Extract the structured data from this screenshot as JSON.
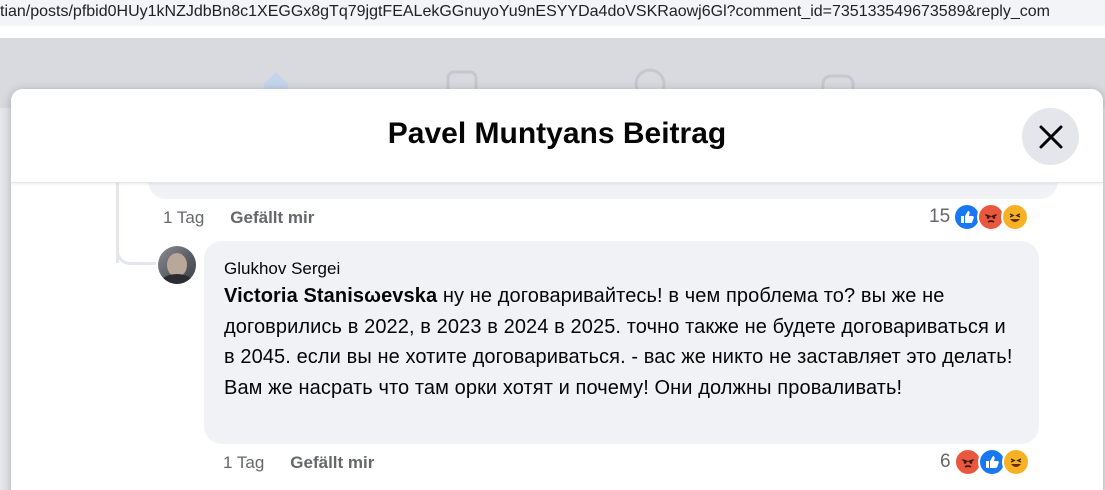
{
  "url": "tian/posts/pfbid0HUy1kNZJdbBn8c1XEGGx8gTq79jgtFEALekGGnuyoYu9nESYYDa4doVSKRaowj6Gl?comment_id=735133549673589&reply_com",
  "modal": {
    "title": "Pavel Muntyans Beitrag"
  },
  "previous_comment": {
    "time": "1 Tag",
    "like_label": "Gefällt mir",
    "reaction_count": "15",
    "reactions": [
      "like",
      "angry",
      "haha"
    ]
  },
  "reply": {
    "author": "Glukhov Sergei",
    "mention": "Victoria Stanisωevska",
    "text": " ну не договаривайтесь! в чем проблема то? вы же не договрились в 2022, в 2023 в 2024 в 2025. точно также не будете договариваться и в 2045. если вы не хотите договариваться. - вас же никто не заставляет это делать! Вам же насрать что там орки хотят и почему! Они должны проваливать!",
    "time": "1 Tag",
    "like_label": "Gefällt mir",
    "reaction_count": "6",
    "reactions": [
      "angry",
      "like",
      "haha"
    ]
  },
  "colors": {
    "like": "#1877f2",
    "angry": "#e9573f",
    "haha": "#f7b125"
  }
}
